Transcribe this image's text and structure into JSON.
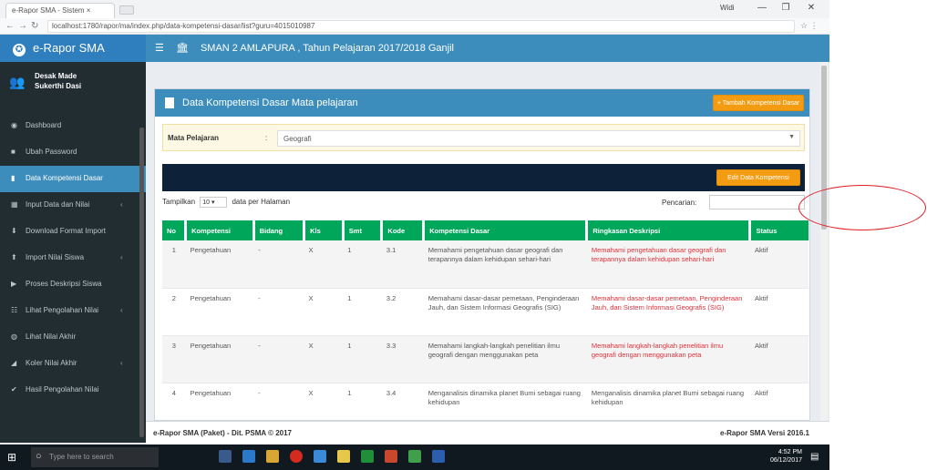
{
  "browser": {
    "tab_title": "e-Rapor SMA - Sistem × ",
    "user": "Widi",
    "url": "localhost:1780/rapor/ma/index.php/data-kompetensi-dasar/list?guru=4015010987",
    "window_minimize": "—",
    "window_maximize": "❐",
    "window_close": "✕"
  },
  "app": {
    "brand": "e-Rapor SMA",
    "school_title": "SMAN 2 AMLAPURA , Tahun Pelajaran 2017/2018 Ganjil"
  },
  "sidebar": {
    "user_name": "Desak Made Sukerthi Dasi",
    "items": [
      {
        "label": "Dashboard",
        "icon": "dashboard-icon"
      },
      {
        "label": "Ubah Password",
        "icon": "lock-icon"
      },
      {
        "label": "Data Kompetensi Dasar",
        "icon": "file-icon"
      },
      {
        "label": "Input Data dan Nilai",
        "icon": "table-icon"
      },
      {
        "label": "Download Format Import",
        "icon": "download-icon"
      },
      {
        "label": "Import Nilai Siswa",
        "icon": "upload-icon"
      },
      {
        "label": "Proses Deskripsi Siswa",
        "icon": "process-icon"
      },
      {
        "label": "Lihat Pengolahan Nilai",
        "icon": "list-icon"
      },
      {
        "label": "Lihat Nilai Akhir",
        "icon": "eye-icon"
      },
      {
        "label": "Koler Nilai Akhir",
        "icon": "chart-icon"
      },
      {
        "label": "Hasil Pengolahan Nilai",
        "icon": "check-icon"
      }
    ]
  },
  "content": {
    "box_title": "Data Kompetensi Dasar Mata pelajaran",
    "add_button": "+ Tambah Kompetensi Dasar",
    "mapel_label": "Mata Pelajaran",
    "mapel_colon": ":",
    "mapel_value": "Geografi",
    "edit_button": "Edit Data Kompetensi",
    "show_label": "Tampilkan",
    "show_value": "10",
    "per_page_label": "data per Halaman",
    "search_label": "Pencarian:",
    "columns": [
      "No",
      "Kompetensi",
      "Bidang",
      "Kls",
      "Smt",
      "Kode",
      "Kompetensi Dasar",
      "Ringkasan Deskripsi",
      "Status"
    ],
    "rows": [
      {
        "no": "1",
        "kompetensi": "Pengetahuan",
        "bidang": "-",
        "kls": "X",
        "smt": "1",
        "kode": "3.1",
        "kd": "Memahami pengetahuan dasar geografi dan terapannya dalam kehidupan sehari-hari",
        "ringkasan": "Memahami pengetahuan dasar geografi dan terapannya dalam kehidupan sehari-hari",
        "status": "Aktif"
      },
      {
        "no": "2",
        "kompetensi": "Pengetahuan",
        "bidang": "-",
        "kls": "X",
        "smt": "1",
        "kode": "3.2",
        "kd": "Memahami dasar-dasar pemetaan, Penginderaan Jauh, dan Sistem Informasi Geografis (SIG)",
        "ringkasan": "Memahami dasar-dasar pemetaan, Penginderaan Jauh, dan Sistem Informasi Geografis (SIG)",
        "status": "Aktif"
      },
      {
        "no": "3",
        "kompetensi": "Pengetahuan",
        "bidang": "-",
        "kls": "X",
        "smt": "1",
        "kode": "3.3",
        "kd": "Memahami langkah-langkah penelitian ilmu geografi dengan menggunakan peta",
        "ringkasan": "Memahami langkah-langkah penelitian ilmu geografi dengan menggunakan peta",
        "status": "Aktif"
      },
      {
        "no": "4",
        "kompetensi": "Pengetahuan",
        "bidang": "-",
        "kls": "X",
        "smt": "1",
        "kode": "3.4",
        "kd": "Menganalisis dinamika planet Bumi sebagai ruang kehidupan",
        "ringkasan": "Menganalisis dinamika planet Bumi sebagai ruang kehidupan",
        "status": "Aktif"
      }
    ]
  },
  "footer": {
    "left": "e-Rapor SMA (Paket) - Dit. PSMA © 2017",
    "right": "e-Rapor SMA Versi 2016.1"
  },
  "taskbar": {
    "search_placeholder": "Type here to search",
    "time": "4:52 PM",
    "date": "06/12/2017"
  },
  "colors": {
    "brand": "#2f7fbf",
    "header": "#3c8dbc",
    "sidebar": "#222d32",
    "table_header": "#00a65a",
    "warning": "#f39c12",
    "annotation": "#e31b23"
  }
}
